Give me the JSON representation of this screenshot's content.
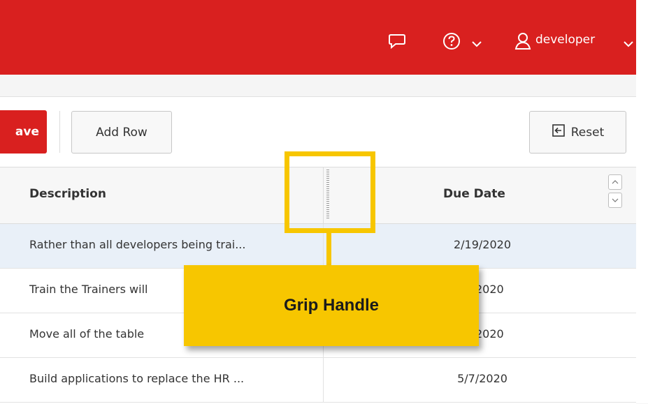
{
  "header": {
    "user_name": "developer",
    "icons": [
      "chat-icon",
      "help-icon",
      "chevron-down-icon",
      "user-icon",
      "chevron-down-icon"
    ]
  },
  "toolbar": {
    "save_label": "ave",
    "add_row_label": "Add Row",
    "reset_label": "Reset"
  },
  "grid": {
    "columns": [
      "Description",
      "Due Date"
    ],
    "rows": [
      {
        "description": "Rather than all developers being trai...",
        "due_date": "2/19/2020"
      },
      {
        "description": "Train the Trainers will",
        "due_date": "2020"
      },
      {
        "description": "Move all of the table",
        "due_date": "2020"
      },
      {
        "description": "Build applications to replace the HR ...",
        "due_date": "5/7/2020"
      }
    ]
  },
  "callout": {
    "label": "Grip Handle"
  },
  "colors": {
    "brand_red": "#d9201f",
    "callout_yellow": "#f7c600",
    "selected_row": "#e9f0f8"
  }
}
